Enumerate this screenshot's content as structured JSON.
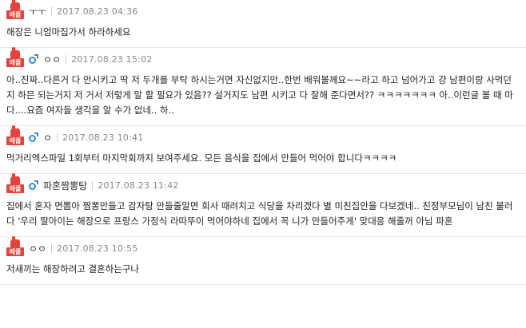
{
  "badge_label": "베플",
  "accent_color": "#e8403a",
  "male_icon_color": "#2f8fd8",
  "comments": [
    {
      "nick": "ㅜㅜ",
      "gender_icon": null,
      "date": "2017.08.23 04:36",
      "text": "해장은 니엄마집가서 하라하세요"
    },
    {
      "nick": "ㅇㅇ",
      "gender_icon": "male-icon",
      "date": "2017.08.23 15:02",
      "text": "아..진짜..다른거 다 안시키고 딱 저 두개를 부탁 하시는거면 자신없지만..한번 배워볼께요~~라고 하고 넘어가고 걍 남편이랑 사먹던지 하믄 되는거지 저 거서 저렇게 말 할 필요가 있음?? 설거지도 남편 시키고 다 잘해 준다면서?? ㅋㅋㅋㅋㅋㅋㅋ 아..이런글 볼 때 마다....요즘 여자들 생각을 알 수가 없네.. 하.."
    },
    {
      "nick": "ㅇ",
      "gender_icon": "male-icon",
      "date": "2017.08.23 10:41",
      "text": "먹거리엑스파일 1회부터 마지막회까지 보여주세요. 모든 음식을 집에서 만들어 먹어야 합니다ㅋㅋㅋㅋ"
    },
    {
      "nick": "파혼짬뽕탕",
      "gender_icon": "male-icon",
      "date": "2017.08.23 11:42",
      "text": "집에서 혼자 면뽑아 짬뽕만들고 감자탕 만들줄알면 회사 때려치고 식당을 차리겠다 별 미친집안을 다보겠네.. 친정부모님이 남친 불러다 '우리 딸아이는 해장으로 프랑스 가정식 라따뚜이 먹어야하네 집에서 꼭 니가 만들어주게' 맞대응 해줄꺼 아님 파혼"
    },
    {
      "nick": "ㅇㅇ",
      "gender_icon": null,
      "date": "2017.08.23 10:55",
      "text": "저새끼는 해장하려고 결혼하는구나"
    }
  ]
}
